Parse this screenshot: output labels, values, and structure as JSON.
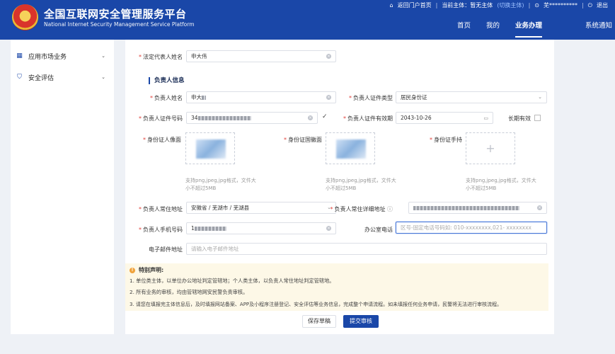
{
  "header": {
    "title_cn": "全国互联网安全管理服务平台",
    "title_en": "National Internet Security Management Service Platform",
    "topbar": {
      "home_link": "返回门户首页",
      "entity_label": "当前主体：",
      "entity_value": "暂无主体",
      "switch_link": "(切换主体)",
      "user": "芜**********",
      "logout": "退出"
    },
    "nav": [
      "首页",
      "我的",
      "业务办理",
      "系统通知"
    ],
    "nav_active": "业务办理"
  },
  "sidebar": {
    "items": [
      {
        "label": "应用市场业务",
        "icon": "grid-icon"
      },
      {
        "label": "安全评估",
        "icon": "shield-icon"
      }
    ]
  },
  "form": {
    "legal_rep": {
      "label": "法定代表人姓名",
      "value": "申大伟"
    },
    "section_title": "负责人信息",
    "name": {
      "label": "负责人姓名",
      "value": "申大"
    },
    "id_type": {
      "label": "负责人证件类型",
      "value": "居民身份证"
    },
    "id_number": {
      "label": "负责人证件号码",
      "value": "34"
    },
    "id_expiry": {
      "label": "负责人证件有效期",
      "value": "2043-10-26"
    },
    "long_term": {
      "label": "长期有效"
    },
    "photo_front": {
      "label": "身份证人像面"
    },
    "photo_back": {
      "label": "身份证国徽面"
    },
    "photo_hand": {
      "label": "身份证手持"
    },
    "upload_hint": [
      "支持png,jpeg,jpg格式，文件大",
      "小不超过5MB"
    ],
    "address": {
      "label": "负责人常住地址",
      "value": "安徽省 / 芜湖市 / 芜湖县"
    },
    "address_detail": {
      "label": "负责人常住详细地址"
    },
    "phone": {
      "label": "负责人手机号码",
      "value": "1"
    },
    "office_phone": {
      "label": "办公室电话",
      "placeholder": "区号-固定电话号码如: 010-xxxxxxxx,021- xxxxxxxx"
    },
    "email": {
      "label": "电子邮件地址",
      "placeholder": "请输入电子邮件地址"
    }
  },
  "notice": {
    "title": "特别声明:",
    "lines": [
      "1. 单位类主体，以单位办公地址判定管辖地；个人类主体，以负责人常住地址判定管辖地。",
      "2. 所有业务的审核，均由管辖地网安民警负责审核。",
      "3. 请您在填报完主体信息后，及时填报网站备案、APP及小程序注册登记、安全评估等业务信息，完成整个申请流程。如未填报任何业务申请，民警将无法进行审核流程。"
    ]
  },
  "buttons": {
    "save": "保存草稿",
    "submit": "提交审核"
  },
  "colors": {
    "brand": "#1a47a8",
    "required": "#e0403a",
    "notice_bg": "#fdf8e7"
  }
}
